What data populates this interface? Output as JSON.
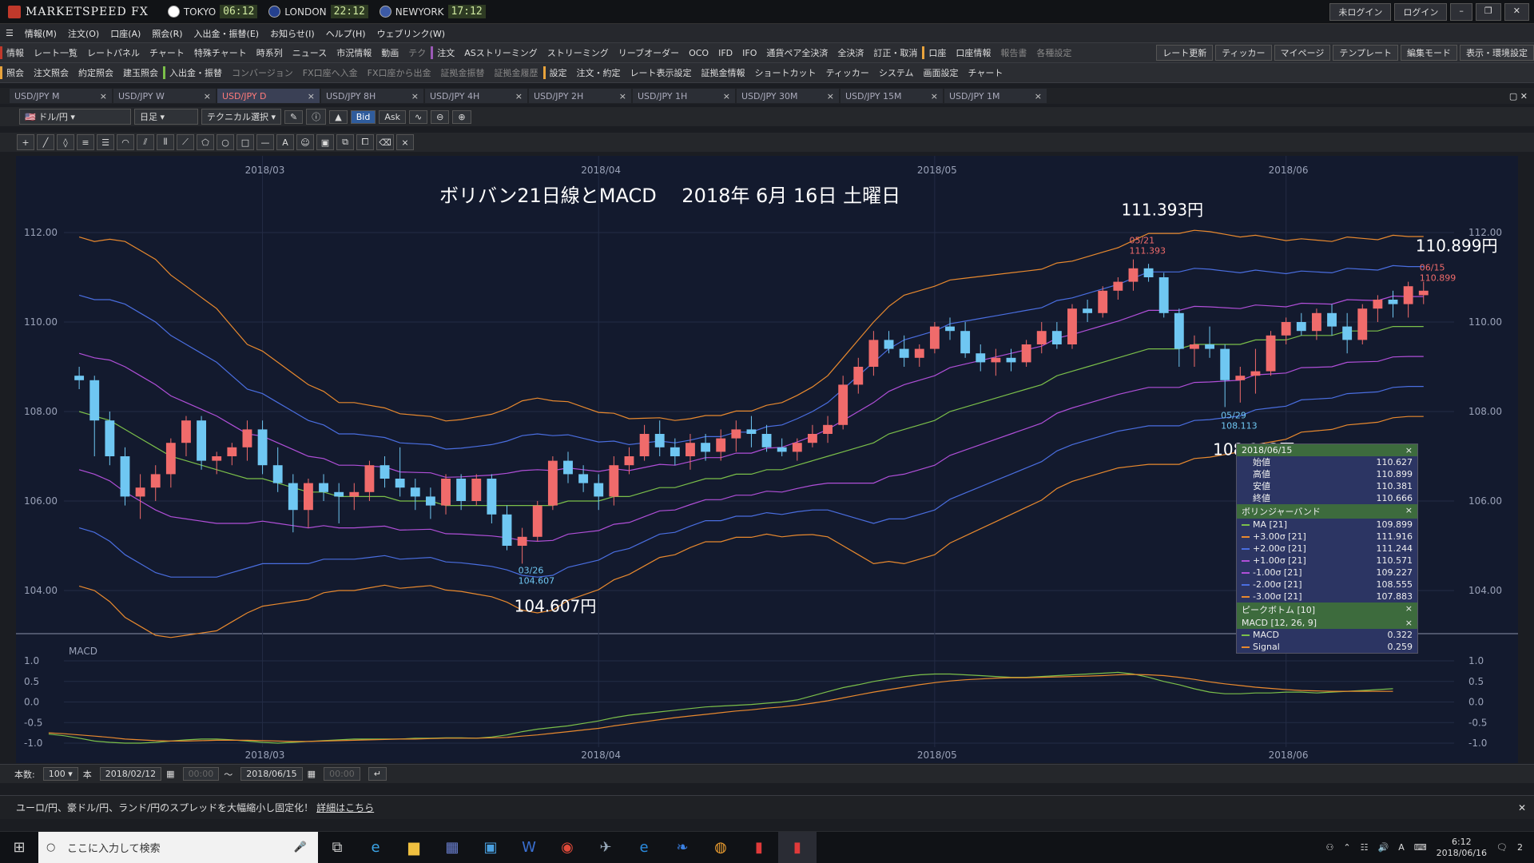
{
  "app": {
    "title": "MARKETSPEED FX",
    "clocks": [
      {
        "city": "TOKYO",
        "time": "06:12"
      },
      {
        "city": "LONDON",
        "time": "22:12"
      },
      {
        "city": "NEWYORK",
        "time": "17:12"
      }
    ],
    "login_status": "未ログイン",
    "login_button": "ログイン"
  },
  "menu": [
    "情報(M)",
    "注文(O)",
    "口座(A)",
    "照会(R)",
    "入出金・振替(E)",
    "お知らせ(I)",
    "ヘルプ(H)",
    "ウェブリンク(W)"
  ],
  "toolbar1": {
    "info_label": "情報",
    "info_items": [
      "レート一覧",
      "レートパネル",
      "チャート",
      "特殊チャート",
      "時系列",
      "ニュース",
      "市況情報",
      "動画",
      "テク"
    ],
    "order_label": "注文",
    "order_items": [
      "ASストリーミング",
      "ストリーミング",
      "リーブオーダー",
      "OCO",
      "IFD",
      "IFO",
      "通貨ペア全決済",
      "全決済",
      "訂正・取消"
    ],
    "account_label": "口座",
    "account_items": [
      "口座情報",
      "報告書",
      "各種設定"
    ],
    "right_buttons": [
      "レート更新",
      "ティッカー",
      "マイページ",
      "テンプレート",
      "編集モード",
      "表示・環境設定"
    ]
  },
  "toolbar2": {
    "inquiry_label": "照会",
    "inquiry_items": [
      "注文照会",
      "約定照会",
      "建玉照会"
    ],
    "deposit_label": "入出金・振替",
    "deposit_items": [
      "コンバージョン",
      "FX口座へ入金",
      "FX口座から出金",
      "証拠金振替",
      "証拠金履歴"
    ],
    "settings_label": "設定",
    "settings_items": [
      "注文・約定",
      "レート表示設定",
      "証拠金情報",
      "ショートカット",
      "ティッカー",
      "システム",
      "画面設定",
      "チャート"
    ]
  },
  "tabs": [
    {
      "label": "USD/JPY M",
      "active": false
    },
    {
      "label": "USD/JPY W",
      "active": false
    },
    {
      "label": "USD/JPY D",
      "active": true
    },
    {
      "label": "USD/JPY 8H",
      "active": false
    },
    {
      "label": "USD/JPY 4H",
      "active": false
    },
    {
      "label": "USD/JPY 2H",
      "active": false
    },
    {
      "label": "USD/JPY 1H",
      "active": false
    },
    {
      "label": "USD/JPY 30M",
      "active": false
    },
    {
      "label": "USD/JPY 15M",
      "active": false
    },
    {
      "label": "USD/JPY 1M",
      "active": false
    }
  ],
  "chart_controls": {
    "pair": "ドル/円",
    "period": "日足",
    "technical": "テクニカル選択",
    "bid": "Bid",
    "ask": "Ask"
  },
  "chart_data": {
    "type": "candlestick",
    "title": "ボリバン21日線とMACD　 2018年 6月 16日 土曜日",
    "x_ticks": [
      "2018/03",
      "2018/04",
      "2018/05",
      "2018/06"
    ],
    "y_ticks": [
      "112.00",
      "110.00",
      "108.00",
      "106.00",
      "104.00"
    ],
    "ylim": [
      103.0,
      113.0
    ],
    "annotations": [
      {
        "big": "111.393円",
        "date": "05/21",
        "value": "111.393"
      },
      {
        "big": "110.899円",
        "date": "06/15",
        "value": "110.899"
      },
      {
        "big": "108.113円",
        "date": "05/29",
        "value": "108.113"
      },
      {
        "big": "104.607円",
        "date": "03/26",
        "value": "104.607"
      }
    ],
    "candles": [
      [
        108.8,
        109.0,
        108.5,
        108.7
      ],
      [
        108.7,
        108.8,
        107.0,
        107.8
      ],
      [
        107.8,
        108.0,
        106.8,
        107.0
      ],
      [
        107.0,
        107.2,
        105.9,
        106.1
      ],
      [
        106.1,
        106.6,
        105.6,
        106.3
      ],
      [
        106.3,
        106.8,
        106.0,
        106.6
      ],
      [
        106.6,
        107.4,
        106.3,
        107.3
      ],
      [
        107.3,
        107.9,
        107.0,
        107.8
      ],
      [
        107.8,
        107.9,
        106.7,
        106.9
      ],
      [
        106.9,
        107.1,
        106.6,
        107.0
      ],
      [
        107.0,
        107.3,
        106.8,
        107.2
      ],
      [
        107.2,
        107.8,
        106.9,
        107.6
      ],
      [
        107.6,
        107.8,
        106.6,
        106.8
      ],
      [
        106.8,
        107.2,
        106.2,
        106.4
      ],
      [
        106.4,
        106.6,
        105.3,
        105.8
      ],
      [
        105.8,
        106.5,
        105.4,
        106.4
      ],
      [
        106.4,
        106.6,
        106.0,
        106.2
      ],
      [
        106.2,
        106.4,
        105.5,
        106.1
      ],
      [
        106.1,
        106.4,
        105.8,
        106.2
      ],
      [
        106.2,
        106.9,
        106.0,
        106.8
      ],
      [
        106.8,
        107.0,
        106.3,
        106.5
      ],
      [
        106.5,
        107.2,
        106.1,
        106.3
      ],
      [
        106.3,
        106.5,
        105.8,
        106.1
      ],
      [
        106.1,
        106.3,
        105.6,
        105.9
      ],
      [
        105.9,
        106.6,
        105.7,
        106.5
      ],
      [
        106.5,
        106.6,
        105.8,
        106.0
      ],
      [
        106.0,
        106.6,
        105.9,
        106.5
      ],
      [
        106.5,
        106.6,
        105.5,
        105.7
      ],
      [
        105.7,
        105.9,
        104.9,
        105.0
      ],
      [
        105.0,
        105.4,
        104.6,
        105.2
      ],
      [
        105.2,
        106.0,
        105.1,
        105.9
      ],
      [
        105.9,
        107.0,
        105.8,
        106.9
      ],
      [
        106.9,
        107.1,
        106.4,
        106.6
      ],
      [
        106.6,
        106.8,
        106.2,
        106.4
      ],
      [
        106.4,
        106.6,
        105.8,
        106.1
      ],
      [
        106.1,
        107.0,
        105.9,
        106.8
      ],
      [
        106.8,
        107.2,
        106.6,
        107.0
      ],
      [
        107.0,
        107.7,
        106.9,
        107.5
      ],
      [
        107.5,
        107.8,
        107.0,
        107.2
      ],
      [
        107.2,
        107.4,
        106.8,
        107.0
      ],
      [
        107.0,
        107.5,
        106.7,
        107.3
      ],
      [
        107.3,
        107.5,
        106.9,
        107.1
      ],
      [
        107.1,
        107.6,
        106.9,
        107.4
      ],
      [
        107.4,
        107.8,
        107.1,
        107.6
      ],
      [
        107.6,
        107.9,
        107.2,
        107.5
      ],
      [
        107.5,
        107.7,
        107.1,
        107.2
      ],
      [
        107.2,
        107.4,
        107.0,
        107.1
      ],
      [
        107.1,
        107.4,
        106.9,
        107.3
      ],
      [
        107.3,
        107.7,
        107.2,
        107.5
      ],
      [
        107.5,
        107.9,
        107.3,
        107.7
      ],
      [
        107.7,
        108.8,
        107.6,
        108.6
      ],
      [
        108.6,
        109.2,
        108.4,
        109.0
      ],
      [
        109.0,
        109.8,
        108.8,
        109.6
      ],
      [
        109.6,
        109.8,
        109.3,
        109.4
      ],
      [
        109.4,
        109.7,
        109.0,
        109.2
      ],
      [
        109.2,
        109.5,
        109.0,
        109.4
      ],
      [
        109.4,
        110.0,
        109.3,
        109.9
      ],
      [
        109.9,
        110.1,
        109.6,
        109.8
      ],
      [
        109.8,
        110.0,
        109.2,
        109.3
      ],
      [
        109.3,
        109.5,
        108.9,
        109.1
      ],
      [
        109.1,
        109.4,
        108.8,
        109.2
      ],
      [
        109.2,
        109.4,
        108.9,
        109.1
      ],
      [
        109.1,
        109.6,
        109.0,
        109.5
      ],
      [
        109.5,
        110.0,
        109.3,
        109.8
      ],
      [
        109.8,
        110.0,
        109.4,
        109.5
      ],
      [
        109.5,
        110.4,
        109.4,
        110.3
      ],
      [
        110.3,
        110.5,
        110.0,
        110.2
      ],
      [
        110.2,
        110.8,
        110.1,
        110.7
      ],
      [
        110.7,
        111.0,
        110.5,
        110.9
      ],
      [
        110.9,
        111.4,
        110.7,
        111.2
      ],
      [
        111.2,
        111.3,
        110.9,
        111.0
      ],
      [
        111.0,
        111.1,
        110.1,
        110.2
      ],
      [
        110.2,
        110.3,
        109.0,
        109.4
      ],
      [
        109.4,
        109.7,
        109.0,
        109.5
      ],
      [
        109.5,
        109.9,
        109.2,
        109.4
      ],
      [
        109.4,
        109.5,
        108.1,
        108.7
      ],
      [
        108.7,
        109.0,
        108.2,
        108.8
      ],
      [
        108.8,
        109.4,
        108.4,
        108.9
      ],
      [
        108.9,
        109.8,
        108.8,
        109.7
      ],
      [
        109.7,
        110.1,
        109.5,
        110.0
      ],
      [
        110.0,
        110.2,
        109.7,
        109.8
      ],
      [
        109.8,
        110.3,
        109.6,
        110.2
      ],
      [
        110.2,
        110.4,
        109.7,
        109.9
      ],
      [
        109.9,
        110.2,
        109.3,
        109.6
      ],
      [
        109.6,
        110.4,
        109.5,
        110.3
      ],
      [
        110.3,
        110.6,
        110.0,
        110.5
      ],
      [
        110.5,
        110.7,
        110.1,
        110.4
      ],
      [
        110.4,
        110.9,
        110.1,
        110.8
      ],
      [
        110.6,
        110.9,
        110.4,
        110.7
      ]
    ],
    "bollinger": {
      "ma": [
        108.0,
        107.9,
        107.8,
        107.6,
        107.4,
        107.2,
        107.0,
        106.9,
        106.8,
        106.7,
        106.6,
        106.5,
        106.5,
        106.4,
        106.3,
        106.2,
        106.2,
        106.1,
        106.1,
        106.1,
        106.1,
        106.0,
        106.0,
        106.0,
        105.9,
        105.9,
        105.9,
        105.9,
        105.9,
        105.9,
        105.9,
        105.9,
        106.0,
        106.0,
        106.0,
        106.1,
        106.1,
        106.2,
        106.3,
        106.3,
        106.4,
        106.5,
        106.5,
        106.6,
        106.6,
        106.7,
        106.7,
        106.8,
        106.9,
        107.0,
        107.1,
        107.2,
        107.3,
        107.5,
        107.6,
        107.7,
        107.8,
        108.0,
        108.1,
        108.2,
        108.3,
        108.4,
        108.5,
        108.6,
        108.8,
        108.9,
        109.0,
        109.1,
        109.2,
        109.3,
        109.4,
        109.4,
        109.4,
        109.5,
        109.5,
        109.5,
        109.5,
        109.6,
        109.6,
        109.6,
        109.7,
        109.7,
        109.7,
        109.8,
        109.8,
        109.8,
        109.9,
        109.9,
        109.9
      ],
      "sd": [
        1.3,
        1.3,
        1.35,
        1.4,
        1.4,
        1.4,
        1.35,
        1.3,
        1.25,
        1.2,
        1.1,
        1.0,
        0.95,
        0.9,
        0.85,
        0.8,
        0.75,
        0.7,
        0.7,
        0.68,
        0.66,
        0.65,
        0.64,
        0.63,
        0.63,
        0.64,
        0.66,
        0.68,
        0.72,
        0.78,
        0.8,
        0.78,
        0.74,
        0.7,
        0.66,
        0.62,
        0.58,
        0.55,
        0.52,
        0.5,
        0.48,
        0.47,
        0.47,
        0.47,
        0.47,
        0.48,
        0.5,
        0.52,
        0.55,
        0.6,
        0.7,
        0.8,
        0.9,
        0.95,
        1.0,
        1.0,
        1.0,
        0.98,
        0.96,
        0.94,
        0.92,
        0.9,
        0.88,
        0.86,
        0.84,
        0.82,
        0.82,
        0.82,
        0.82,
        0.84,
        0.86,
        0.86,
        0.86,
        0.85,
        0.84,
        0.82,
        0.8,
        0.78,
        0.76,
        0.74,
        0.72,
        0.71,
        0.7,
        0.7,
        0.69,
        0.68,
        0.68,
        0.67,
        0.67
      ]
    },
    "macd_panel": {
      "label": "MACD",
      "y_ticks": [
        "1.0",
        "0.5",
        "0.0",
        "-0.5",
        "-1.0"
      ],
      "macd": [
        -0.78,
        -0.82,
        -0.88,
        -0.95,
        -0.98,
        -1.0,
        -1.0,
        -0.98,
        -0.95,
        -0.92,
        -0.9,
        -0.9,
        -0.92,
        -0.95,
        -0.98,
        -1.0,
        -0.98,
        -0.96,
        -0.94,
        -0.92,
        -0.9,
        -0.9,
        -0.9,
        -0.9,
        -0.88,
        -0.88,
        -0.87,
        -0.87,
        -0.88,
        -0.85,
        -0.8,
        -0.72,
        -0.66,
        -0.62,
        -0.58,
        -0.52,
        -0.46,
        -0.38,
        -0.32,
        -0.28,
        -0.24,
        -0.2,
        -0.16,
        -0.12,
        -0.1,
        -0.08,
        -0.06,
        -0.03,
        0.0,
        0.05,
        0.15,
        0.25,
        0.35,
        0.42,
        0.5,
        0.56,
        0.62,
        0.66,
        0.68,
        0.68,
        0.66,
        0.64,
        0.62,
        0.6,
        0.6,
        0.62,
        0.64,
        0.66,
        0.68,
        0.7,
        0.72,
        0.68,
        0.6,
        0.5,
        0.42,
        0.32,
        0.24,
        0.2,
        0.2,
        0.22,
        0.22,
        0.24,
        0.24,
        0.22,
        0.24,
        0.26,
        0.28,
        0.3,
        0.322
      ],
      "signal": [
        -0.75,
        -0.77,
        -0.8,
        -0.83,
        -0.86,
        -0.9,
        -0.92,
        -0.94,
        -0.95,
        -0.95,
        -0.94,
        -0.93,
        -0.93,
        -0.93,
        -0.94,
        -0.95,
        -0.96,
        -0.96,
        -0.95,
        -0.94,
        -0.93,
        -0.92,
        -0.91,
        -0.9,
        -0.9,
        -0.89,
        -0.88,
        -0.88,
        -0.88,
        -0.87,
        -0.86,
        -0.83,
        -0.8,
        -0.76,
        -0.72,
        -0.68,
        -0.64,
        -0.58,
        -0.53,
        -0.48,
        -0.43,
        -0.38,
        -0.34,
        -0.3,
        -0.26,
        -0.22,
        -0.19,
        -0.15,
        -0.12,
        -0.08,
        -0.03,
        0.03,
        0.1,
        0.17,
        0.24,
        0.3,
        0.36,
        0.42,
        0.47,
        0.51,
        0.54,
        0.56,
        0.58,
        0.59,
        0.59,
        0.6,
        0.61,
        0.62,
        0.63,
        0.64,
        0.66,
        0.67,
        0.66,
        0.64,
        0.6,
        0.55,
        0.49,
        0.44,
        0.4,
        0.36,
        0.33,
        0.3,
        0.28,
        0.27,
        0.26,
        0.26,
        0.26,
        0.26,
        0.259
      ]
    }
  },
  "info_panel": {
    "date": "2018/06/15",
    "ohlc": [
      {
        "label": "始値",
        "value": "110.627"
      },
      {
        "label": "高値",
        "value": "110.899"
      },
      {
        "label": "安値",
        "value": "110.381"
      },
      {
        "label": "終値",
        "value": "110.666"
      }
    ],
    "bb_title": "ボリンジャーバンド",
    "bb": [
      {
        "label": "MA [21]",
        "value": "109.899",
        "color": "#7bbf4a"
      },
      {
        "label": "+3.00σ [21]",
        "value": "111.916",
        "color": "#e8892e"
      },
      {
        "label": "+2.00σ [21]",
        "value": "111.244",
        "color": "#4a6ee0"
      },
      {
        "label": "+1.00σ [21]",
        "value": "110.571",
        "color": "#b04fd8"
      },
      {
        "label": "-1.00σ [21]",
        "value": "109.227",
        "color": "#b04fd8"
      },
      {
        "label": "-2.00σ [21]",
        "value": "108.555",
        "color": "#4a6ee0"
      },
      {
        "label": "-3.00σ [21]",
        "value": "107.883",
        "color": "#e8892e"
      }
    ],
    "peak_title": "ピークボトム [10]",
    "macd_title": "MACD [12, 26, 9]",
    "macd": [
      {
        "label": "MACD",
        "value": "0.322",
        "color": "#7bbf4a"
      },
      {
        "label": "Signal",
        "value": "0.259",
        "color": "#e8892e"
      }
    ]
  },
  "range_bar": {
    "count_label": "本数:",
    "count_value": "100",
    "unit": "本",
    "start_date": "2018/02/12",
    "start_time": "00:00",
    "tilde": "～",
    "end_date": "2018/06/15",
    "end_time": "00:00"
  },
  "news": {
    "text": "ユーロ/円、豪ドル/円、ランド/円のスプレッドを大幅縮小し固定化！",
    "link": "詳細はこちら"
  },
  "taskbar": {
    "search_placeholder": "ここに入力して検索",
    "time": "6:12",
    "date": "2018/06/16",
    "ime": "A",
    "notif_count": "2"
  },
  "colors": {
    "up": "#f06b6b",
    "down": "#6fc7f2",
    "chart_bg": "#131a2e",
    "accent_orange": "#e8892e"
  }
}
